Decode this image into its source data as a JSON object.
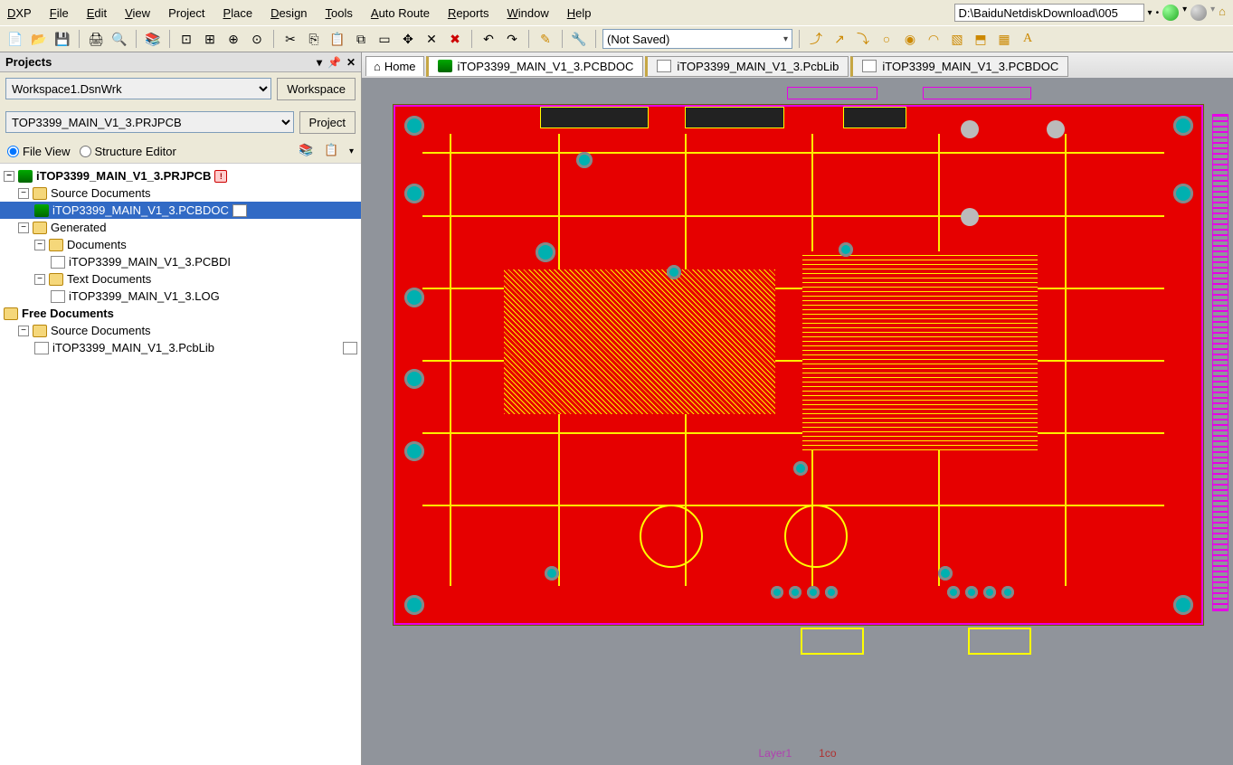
{
  "menu": {
    "dxp": "DXP",
    "file": "File",
    "edit": "Edit",
    "view": "View",
    "project": "Project",
    "place": "Place",
    "design": "Design",
    "tools": "Tools",
    "autoroute": "Auto Route",
    "reports": "Reports",
    "window": "Window",
    "help": "Help"
  },
  "path": "D:\\BaiduNetdiskDownload\\005",
  "toolbar": {
    "not_saved": "(Not Saved)"
  },
  "sidebar": {
    "title": "Projects",
    "workspace_value": "Workspace1.DsnWrk",
    "workspace_button": "Workspace",
    "project_value": "TOP3399_MAIN_V1_3.PRJPCB",
    "project_button": "Project",
    "file_view": "File View",
    "structure_editor": "Structure Editor",
    "tree": {
      "root": "iTOP3399_MAIN_V1_3.PRJPCB",
      "src_docs": "Source Documents",
      "pcbdoc": "iTOP3399_MAIN_V1_3.PCBDOC",
      "generated": "Generated",
      "documents": "Documents",
      "pcbdi": "iTOP3399_MAIN_V1_3.PCBDI",
      "text_docs": "Text Documents",
      "log": "iTOP3399_MAIN_V1_3.LOG",
      "free_docs": "Free Documents",
      "free_src": "Source Documents",
      "pcblib": "iTOP3399_MAIN_V1_3.PcbLib"
    }
  },
  "tabs": {
    "home": "Home",
    "t1": "iTOP3399_MAIN_V1_3.PCBDOC",
    "t2": "iTOP3399_MAIN_V1_3.PcbLib",
    "t3": "iTOP3399_MAIN_V1_3.PCBDOC"
  },
  "status": {
    "layer": "Layer1",
    "extra": "1co"
  }
}
